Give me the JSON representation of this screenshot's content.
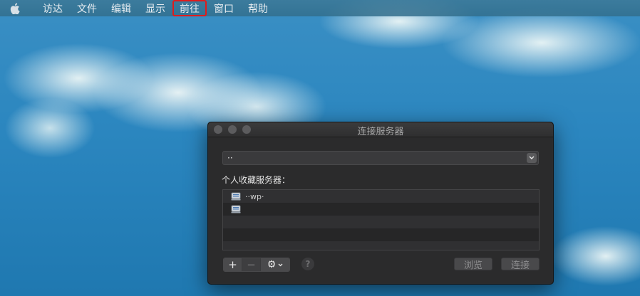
{
  "menubar": {
    "items": [
      {
        "label": "访达"
      },
      {
        "label": "文件"
      },
      {
        "label": "编辑"
      },
      {
        "label": "显示"
      },
      {
        "label": "前往"
      },
      {
        "label": "窗口"
      },
      {
        "label": "帮助"
      }
    ],
    "highlighted_index": 4,
    "highlight_color": "#e01b1b"
  },
  "dialog": {
    "title": "连接服务器",
    "address_value": "  ··",
    "favorites_label": "个人收藏服务器：",
    "favorites": [
      {
        "label": "··wp·"
      },
      {
        "label": ""
      }
    ],
    "buttons": {
      "add": "+",
      "remove": "−",
      "gear": "⚙",
      "help": "?",
      "browse": "浏览",
      "connect": "连接"
    }
  },
  "colors": {
    "dialog_bg": "#2b2b2c",
    "desktop_sky": "#2a86bf"
  }
}
